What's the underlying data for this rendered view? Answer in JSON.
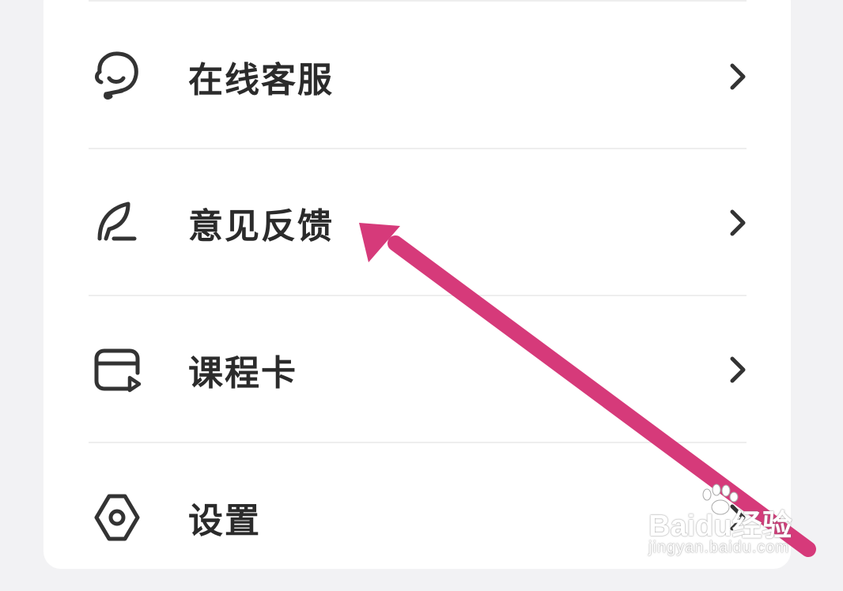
{
  "menu": {
    "items": [
      {
        "label": "在线客服",
        "icon": "headset-icon"
      },
      {
        "label": "意见反馈",
        "icon": "feather-pen-icon"
      },
      {
        "label": "课程卡",
        "icon": "course-card-icon"
      },
      {
        "label": "设置",
        "icon": "settings-gear-icon"
      }
    ]
  },
  "colors": {
    "annotation_arrow": "#d63a7a",
    "text": "#2b2b2b",
    "divider": "#eeeeee",
    "icon_stroke": "#333333"
  },
  "watermark": {
    "brand": "Baidu经验",
    "url": "jingyan.baidu.com"
  }
}
